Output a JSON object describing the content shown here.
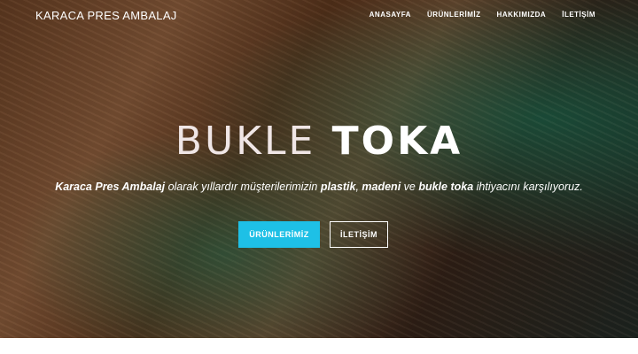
{
  "brand": {
    "name": "KARACA PRES AMBALAJ"
  },
  "nav": [
    {
      "label": "ANASAYFA"
    },
    {
      "label": "ÜRÜNLERİMİZ"
    },
    {
      "label": "HAKKIMIZDA"
    },
    {
      "label": "İLETİŞİM"
    }
  ],
  "hero": {
    "title_part1": "BUKLE",
    "title_part2": "TOKA",
    "desc": {
      "company": "Karaca Pres Ambalaj",
      "t1": " olarak yıllardır müşterilerimizin ",
      "w1": "plastik",
      "t2": ", ",
      "w2": "madeni",
      "t3": " ve ",
      "w3": "bukle toka",
      "t4": " ihtiyacını karşılıyoruz."
    },
    "primary_button": "ÜRÜNLERİMİZ",
    "secondary_button": "İLETİŞİM"
  },
  "colors": {
    "accent": "#1ec0e6",
    "text": "#ffffff"
  }
}
